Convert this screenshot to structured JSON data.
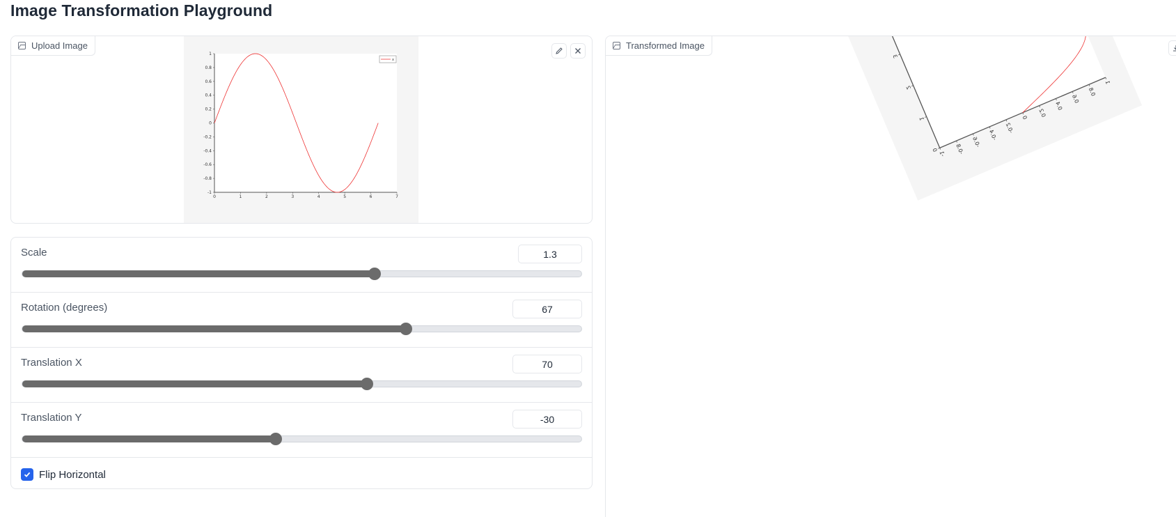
{
  "page": {
    "title": "Image Transformation Playground"
  },
  "upload": {
    "label": "Upload Image",
    "edit_icon": "pencil-icon",
    "close_icon": "close-icon",
    "plot": {
      "legend": "x",
      "yticks": [
        "1",
        "0.8",
        "0.6",
        "0.4",
        "0.2",
        "0",
        "-0.2",
        "-0.4",
        "-0.6",
        "-0.8",
        "-1"
      ],
      "xticks": [
        "0",
        "1",
        "2",
        "3",
        "4",
        "5",
        "6",
        "7"
      ]
    }
  },
  "controls": {
    "scale": {
      "label": "Scale",
      "value": "1.3",
      "fraction": 0.63
    },
    "rotation": {
      "label": "Rotation (degrees)",
      "value": "67",
      "fraction": 0.686
    },
    "translation_x": {
      "label": "Translation X",
      "value": "70",
      "fraction": 0.617
    },
    "translation_y": {
      "label": "Translation Y",
      "value": "-30",
      "fraction": 0.453
    },
    "flip": {
      "label": "Flip Horizontal",
      "checked": true
    }
  },
  "output": {
    "label": "Transformed Image",
    "download_icon": "download-icon"
  },
  "colors": {
    "accent": "#2563eb",
    "curve": "#ee3333",
    "slider_fill": "#6b6b6b"
  }
}
